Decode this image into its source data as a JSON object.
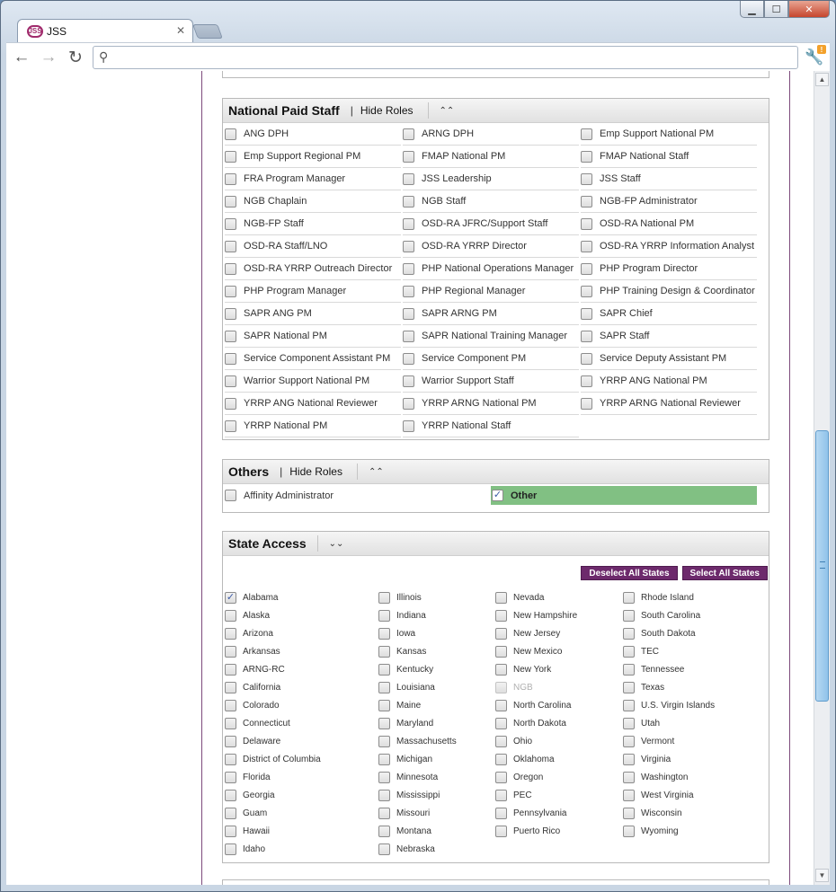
{
  "browser": {
    "tab_title": "JSS",
    "favicon_text": "JSS",
    "address_value": "",
    "win_min": "▁",
    "win_max": "☐",
    "win_close": "✕",
    "tab_close": "✕",
    "back_glyph": "←",
    "forward_glyph": "→",
    "reload_glyph": "↻",
    "search_glyph": "⚲",
    "wrench_glyph": "🔧",
    "wrench_badge": "!"
  },
  "national_paid_staff": {
    "title": "National Paid Staff",
    "separator": "|",
    "hide_roles": "Hide Roles",
    "collapse_glyph": "⌃⌃",
    "roles": [
      [
        "ANG DPH",
        "ARNG DPH",
        "Emp Support National PM"
      ],
      [
        "Emp Support Regional PM",
        "FMAP National PM",
        "FMAP National Staff"
      ],
      [
        "FRA Program Manager",
        "JSS Leadership",
        "JSS Staff"
      ],
      [
        "NGB Chaplain",
        "NGB Staff",
        "NGB-FP Administrator"
      ],
      [
        "NGB-FP Staff",
        "OSD-RA JFRC/Support Staff",
        "OSD-RA National PM"
      ],
      [
        "OSD-RA Staff/LNO",
        "OSD-RA YRRP Director",
        "OSD-RA YRRP Information Analyst"
      ],
      [
        "OSD-RA YRRP Outreach Director",
        "PHP National Operations Manager",
        "PHP Program Director"
      ],
      [
        "PHP Program Manager",
        "PHP Regional Manager",
        "PHP Training Design & Coordinator"
      ],
      [
        "SAPR ANG PM",
        "SAPR ARNG PM",
        "SAPR Chief"
      ],
      [
        "SAPR National PM",
        "SAPR National Training Manager",
        "SAPR Staff"
      ],
      [
        "Service Component Assistant PM",
        "Service Component PM",
        "Service Deputy Assistant PM"
      ],
      [
        "Warrior Support National PM",
        "Warrior Support Staff",
        "YRRP ANG National PM"
      ],
      [
        "YRRP ANG National Reviewer",
        "YRRP ARNG National PM",
        "YRRP ARNG National Reviewer"
      ],
      [
        "YRRP National PM",
        "YRRP National Staff"
      ]
    ]
  },
  "others": {
    "title": "Others",
    "separator": "|",
    "hide_roles": "Hide Roles",
    "collapse_glyph": "⌃⌃",
    "roles": [
      {
        "label": "Affinity Administrator",
        "checked": false
      },
      {
        "label": "Other",
        "checked": true,
        "highlight": "#81c083"
      }
    ]
  },
  "state_access": {
    "title": "State Access",
    "expand_glyph": "⌄⌄",
    "deselect_all": "Deselect All States",
    "select_all": "Select All States",
    "check_glyph": "✓",
    "columns": [
      [
        {
          "label": "Alabama",
          "checked": true
        },
        {
          "label": "Alaska"
        },
        {
          "label": "Arizona"
        },
        {
          "label": "Arkansas"
        },
        {
          "label": "ARNG-RC"
        },
        {
          "label": "California"
        },
        {
          "label": "Colorado"
        },
        {
          "label": "Connecticut"
        },
        {
          "label": "Delaware"
        },
        {
          "label": "District of Columbia"
        },
        {
          "label": "Florida"
        },
        {
          "label": "Georgia"
        },
        {
          "label": "Guam"
        },
        {
          "label": "Hawaii"
        },
        {
          "label": "Idaho"
        }
      ],
      [
        {
          "label": "Illinois"
        },
        {
          "label": "Indiana"
        },
        {
          "label": "Iowa"
        },
        {
          "label": "Kansas"
        },
        {
          "label": "Kentucky"
        },
        {
          "label": "Louisiana"
        },
        {
          "label": "Maine"
        },
        {
          "label": "Maryland"
        },
        {
          "label": "Massachusetts"
        },
        {
          "label": "Michigan"
        },
        {
          "label": "Minnesota"
        },
        {
          "label": "Mississippi"
        },
        {
          "label": "Missouri"
        },
        {
          "label": "Montana"
        },
        {
          "label": "Nebraska"
        }
      ],
      [
        {
          "label": "Nevada"
        },
        {
          "label": "New Hampshire"
        },
        {
          "label": "New Jersey"
        },
        {
          "label": "New Mexico"
        },
        {
          "label": "New York"
        },
        {
          "label": "NGB",
          "disabled": true
        },
        {
          "label": "North Carolina"
        },
        {
          "label": "North Dakota"
        },
        {
          "label": "Ohio"
        },
        {
          "label": "Oklahoma"
        },
        {
          "label": "Oregon"
        },
        {
          "label": "PEC"
        },
        {
          "label": "Pennsylvania"
        },
        {
          "label": "Puerto Rico"
        }
      ],
      [
        {
          "label": "Rhode Island"
        },
        {
          "label": "South Carolina"
        },
        {
          "label": "South Dakota"
        },
        {
          "label": "TEC"
        },
        {
          "label": "Tennessee"
        },
        {
          "label": "Texas"
        },
        {
          "label": "U.S. Virgin Islands"
        },
        {
          "label": "Utah"
        },
        {
          "label": "Vermont"
        },
        {
          "label": "Virginia"
        },
        {
          "label": "Washington"
        },
        {
          "label": "West Virginia"
        },
        {
          "label": "Wisconsin"
        },
        {
          "label": "Wyoming"
        }
      ]
    ]
  },
  "colors": {
    "accent_purple": "#6d2a6c",
    "highlight_green": "#81c083",
    "checkmark_blue": "#3b5aa5"
  },
  "scrollbar": {
    "up_glyph": "▲",
    "down_glyph": "▼"
  }
}
